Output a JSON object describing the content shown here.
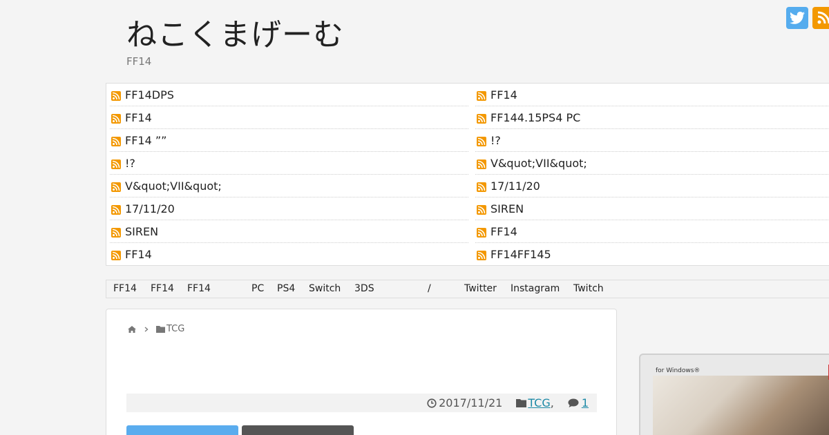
{
  "site": {
    "title": "ねこくまげーむ",
    "description": "FF14"
  },
  "social": {
    "twitter_icon": "twitter-icon",
    "rss_icon": "rss-icon",
    "twitter_color": "#55acee",
    "rss_color": "#f39800"
  },
  "feeds": {
    "left": [
      "FF14DPS",
      "FF14",
      "FF14 ””",
      "!?",
      "V&quot;VII&quot;",
      "17/11/20",
      "SIREN",
      "FF14"
    ],
    "right": [
      "FF14",
      "FF144.15PS4 PC",
      "!?",
      "V&quot;VII&quot;",
      "17/11/20",
      "SIREN",
      "FF14",
      "FF14FF145"
    ]
  },
  "nav": [
    "FF14",
    "FF14",
    "FF14",
    "PC",
    "PS4",
    "Switch",
    "3DS",
    "/",
    "Twitter",
    "Instagram",
    "Twitch"
  ],
  "breadcrumb": {
    "category": "TCG"
  },
  "post_meta": {
    "date": "2017/11/21",
    "category": "TCG",
    "separator": ",",
    "comments": "1"
  },
  "sidebar": {
    "product_label": "for Windows®"
  }
}
